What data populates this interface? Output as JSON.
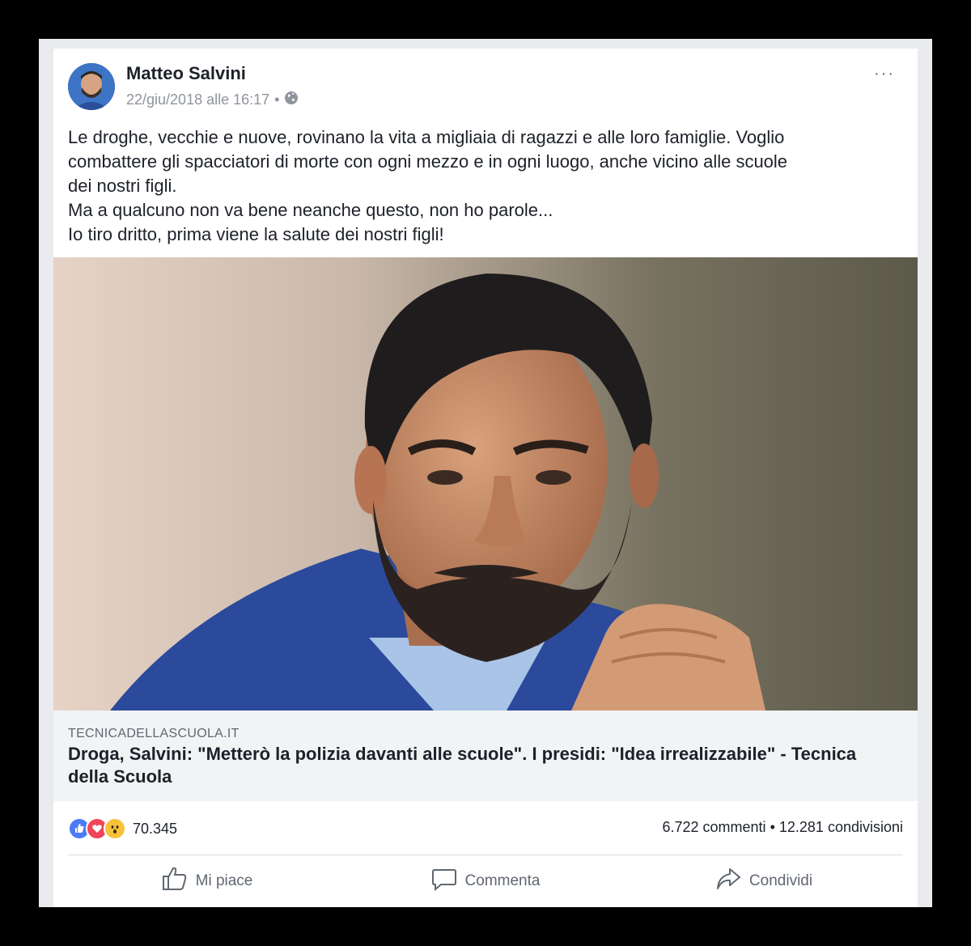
{
  "post": {
    "author": "Matteo Salvini",
    "timestamp": "22/giu/2018 alle 16:17",
    "separator": "•",
    "privacy_icon": "globe-icon",
    "more_label": "···",
    "text_lines": [
      "Le droghe, vecchie e nuove, rovinano la vita a migliaia di ragazzi e alle loro famiglie. Voglio",
      "combattere gli spacciatori di morte con ogni mezzo e in ogni luogo, anche vicino alle scuole",
      "dei nostri figli.",
      "Ma a qualcuno non va bene neanche questo, non ho parole...",
      "Io tiro dritto, prima viene la salute dei nostri figli!"
    ]
  },
  "link": {
    "domain": "TECNICADELLASCUOLA.IT",
    "title": "Droga, Salvini: \"Metterò la polizia davanti alle scuole\". I presidi: \"Idea irrealizzabile\" - Tecnica della Scuola"
  },
  "stats": {
    "reaction_icons": [
      "like-icon",
      "love-icon",
      "wow-icon"
    ],
    "reactions_count": "70.345",
    "comments": "6.722 commenti",
    "shares": "12.281 condivisioni",
    "dot": "•"
  },
  "actions": {
    "like": "Mi piace",
    "comment": "Commenta",
    "share": "Condividi"
  },
  "colors": {
    "like_blue": "#4a7cf7",
    "love_red": "#f0455b",
    "wow_yellow": "#f7c23b",
    "text": "#1d2129",
    "muted": "#606770"
  }
}
